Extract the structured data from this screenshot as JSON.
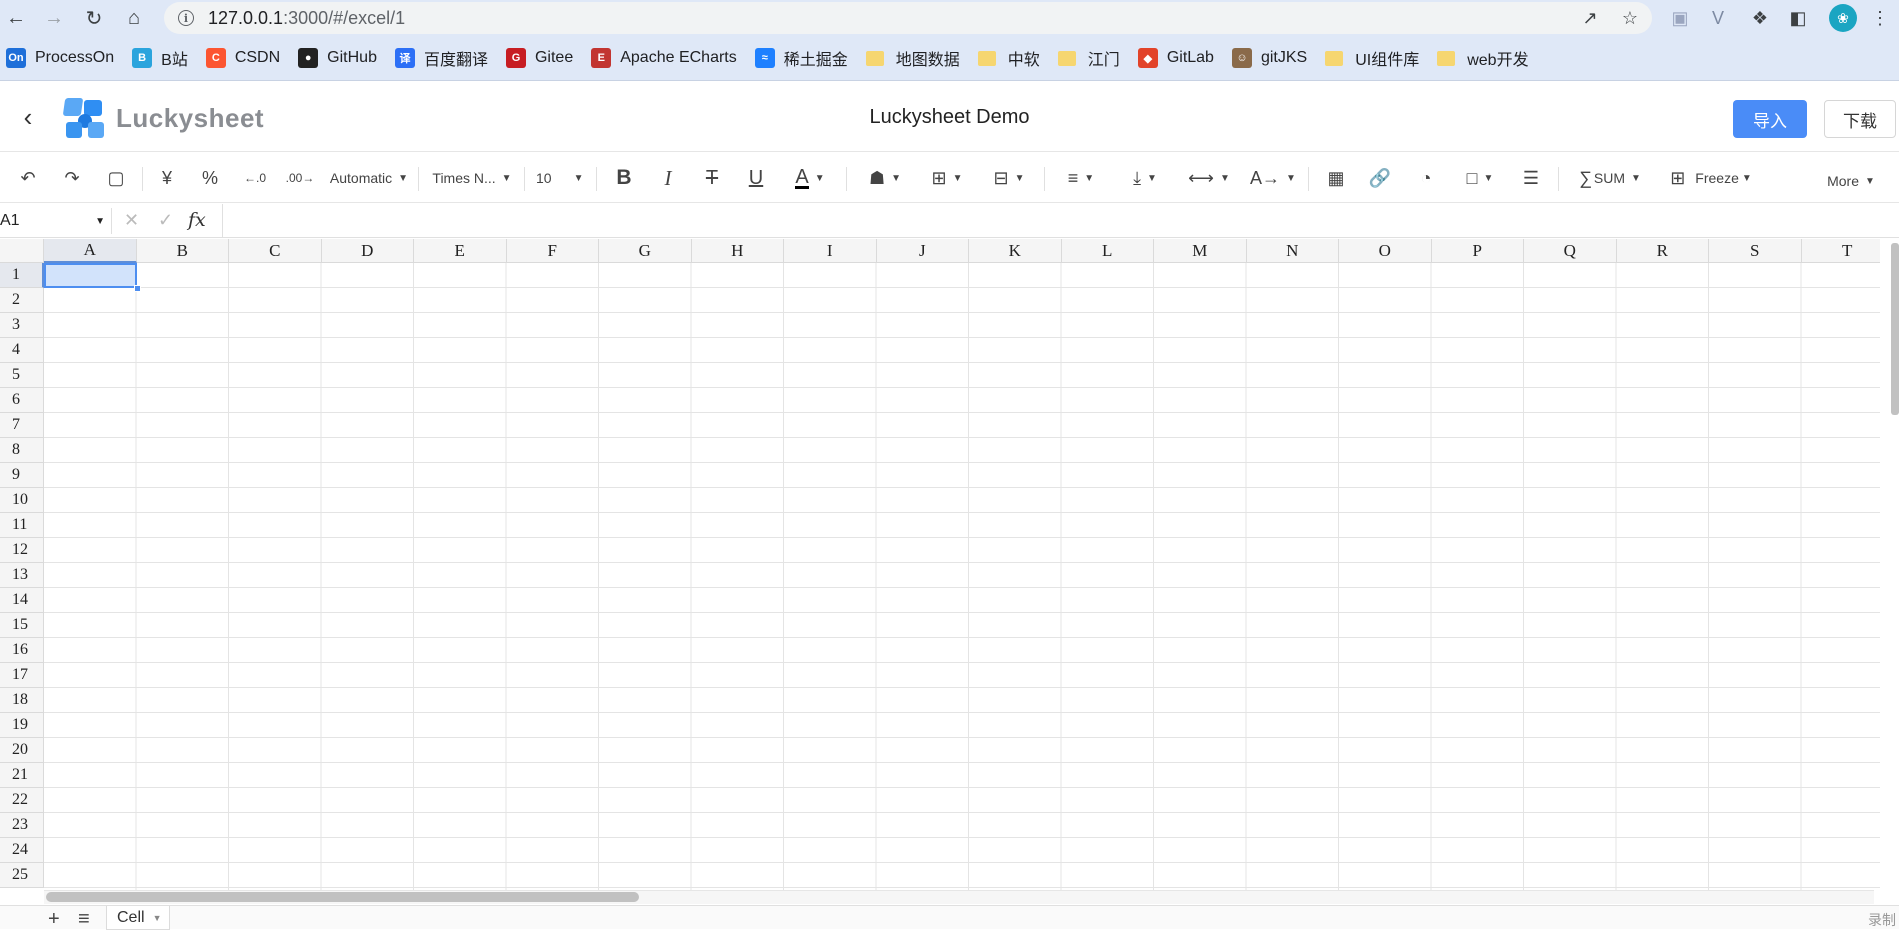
{
  "browser": {
    "url_host": "127.0.0.1",
    "url_path": ":3000/#/excel/1",
    "avatar_letter": "❀",
    "bookmarks": [
      {
        "label": "ProcessOn",
        "icon": "On",
        "color": "#1e6fd9"
      },
      {
        "label": "B站",
        "icon": "B",
        "color": "#2aa4dd"
      },
      {
        "label": "CSDN",
        "icon": "C",
        "color": "#fc5531"
      },
      {
        "label": "GitHub",
        "icon": "●",
        "color": "#222222"
      },
      {
        "label": "百度翻译",
        "icon": "译",
        "color": "#2c6ff6"
      },
      {
        "label": "Gitee",
        "icon": "G",
        "color": "#c71d23"
      },
      {
        "label": "Apache ECharts",
        "icon": "E",
        "color": "#c23531"
      },
      {
        "label": "稀土掘金",
        "icon": "≈",
        "color": "#1e80ff"
      },
      {
        "label": "地图数据",
        "icon": "folder"
      },
      {
        "label": "中软",
        "icon": "folder"
      },
      {
        "label": "江门",
        "icon": "folder"
      },
      {
        "label": "GitLab",
        "icon": "◆",
        "color": "#e24329"
      },
      {
        "label": "gitJKS",
        "icon": "☺",
        "color": "#8a6a4a"
      },
      {
        "label": "UI组件库",
        "icon": "folder"
      },
      {
        "label": "web开发",
        "icon": "folder"
      }
    ]
  },
  "app": {
    "logo_text": "Luckysheet",
    "title": "Luckysheet Demo",
    "import_label": "导入",
    "download_label": "下载"
  },
  "toolbar": {
    "currency_symbol": "¥",
    "percent_symbol": "%",
    "number_format": "Automatic",
    "font_family": "Times N...",
    "font_size": "10",
    "bold": "B",
    "italic": "I",
    "strikethrough": "T",
    "underline": "U",
    "text_color_glyph": "A",
    "sum_label": "SUM",
    "freeze_label": "Freeze",
    "more_label": "More"
  },
  "formula_bar": {
    "cell_ref": "A1",
    "fx": "fx"
  },
  "sheet": {
    "columns": [
      "A",
      "B",
      "C",
      "D",
      "E",
      "F",
      "G",
      "H",
      "I",
      "J",
      "K",
      "L",
      "M",
      "N",
      "O",
      "P",
      "Q",
      "R",
      "S",
      "T"
    ],
    "rows": [
      "1",
      "2",
      "3",
      "4",
      "5",
      "6",
      "7",
      "8",
      "9",
      "10",
      "11",
      "12",
      "13",
      "14",
      "15",
      "16",
      "17",
      "18",
      "19",
      "20",
      "21",
      "22",
      "23",
      "24",
      "25"
    ],
    "selected_column": "A",
    "selected_row": "1",
    "tab_name": "Cell"
  },
  "status": {
    "right_text": "录制"
  }
}
